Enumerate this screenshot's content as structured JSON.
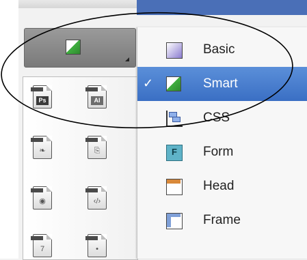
{
  "trigger": {
    "current_icon": "smart-swatch-icon",
    "arrow_icon": "corner-arrow-icon"
  },
  "palette": {
    "tools": [
      {
        "name": "photoshop-doc-icon",
        "tag": "Ps"
      },
      {
        "name": "illustrator-doc-icon",
        "tag": "AI"
      },
      {
        "name": "pdf-doc-icon",
        "glyph": "❧"
      },
      {
        "name": "link-doc-icon",
        "glyph": "⎘"
      },
      {
        "name": "disc-doc-icon",
        "glyph": "◉"
      },
      {
        "name": "code-doc-icon",
        "glyph": "‹/›"
      },
      {
        "name": "calendar-doc-icon",
        "glyph": "7"
      },
      {
        "name": "info-doc-icon",
        "glyph": "•"
      }
    ]
  },
  "menu": {
    "items": [
      {
        "label": "Basic",
        "icon": "basic-swatch-icon",
        "selected": false
      },
      {
        "label": "Smart",
        "icon": "smart-swatch-icon",
        "selected": true,
        "check": "✓"
      },
      {
        "label": "CSS",
        "icon": "css-layout-icon",
        "selected": false
      },
      {
        "label": "Form",
        "icon": "form-icon",
        "selected": false,
        "icon_letter": "F"
      },
      {
        "label": "Head",
        "icon": "head-icon",
        "selected": false
      },
      {
        "label": "Frame",
        "icon": "frame-icon",
        "selected": false
      }
    ]
  },
  "colors": {
    "selection": "#3a6fc4",
    "annotation": "#000000"
  }
}
